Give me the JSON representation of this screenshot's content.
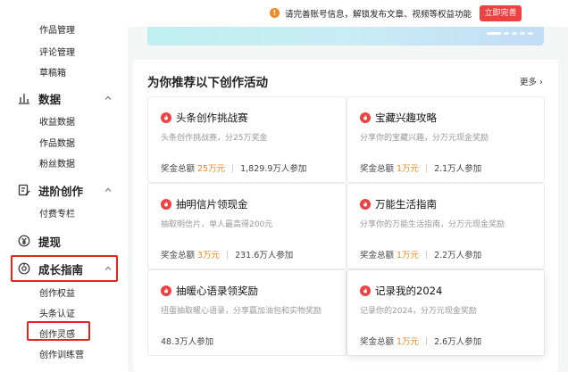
{
  "topbar": {
    "notice_icon": "!",
    "notice_text": "请完善账号信息，解锁发布文章、视频等权益功能",
    "cta_label": "立即完善"
  },
  "sidebar": {
    "content_items": [
      "作品管理",
      "评论管理",
      "草稿箱"
    ],
    "groups": [
      {
        "title": "数据",
        "icon": "bar-chart-icon",
        "items": [
          "收益数据",
          "作品数据",
          "粉丝数据"
        ]
      },
      {
        "title": "进阶创作",
        "icon": "edit-doc-icon",
        "items": [
          "付费专栏"
        ]
      },
      {
        "title": "提现",
        "icon": "yen-icon",
        "items": []
      },
      {
        "title": "成长指南",
        "icon": "growth-guide-icon",
        "items": [
          "创作权益",
          "头条认证",
          "创作灵感",
          "创作训练营"
        ]
      }
    ]
  },
  "section": {
    "title": "为你推荐以下创作活动",
    "more": "更多"
  },
  "colors": {
    "accent": "#f04142",
    "highlight": "#f08a24",
    "selection_box": "#e1251b"
  },
  "cards": [
    {
      "title": "头条创作挑战赛",
      "desc": "头条创作挑战赛，分25万奖金",
      "prize_label": "奖金总额",
      "prize": "25万元",
      "participants": "1,829.9万人参加"
    },
    {
      "title": "宝藏兴趣攻略",
      "desc": "分享你的宝藏兴趣，分万元现金奖励",
      "prize_label": "奖金总额",
      "prize": "1万元",
      "participants": "2.1万人参加"
    },
    {
      "title": "抽明信片领现金",
      "desc": "抽取明信片，单人最高得200元",
      "prize_label": "奖金总额",
      "prize": "3万元",
      "participants": "231.6万人参加"
    },
    {
      "title": "万能生活指南",
      "desc": "分享你的万能生活指南，分万元现金奖励",
      "prize_label": "奖金总额",
      "prize": "1万元",
      "participants": "2.2万人参加"
    },
    {
      "title": "抽暖心语录领奖励",
      "desc": "扭蛋抽取暖心语录，分享赢加油包和实物奖励",
      "participants": "48.3万人参加"
    },
    {
      "title": "记录我的2024",
      "desc": "记录你的2024，分万元现金奖励",
      "prize_label": "奖金总额",
      "prize": "1万元",
      "participants": "2.6万人参加"
    }
  ]
}
